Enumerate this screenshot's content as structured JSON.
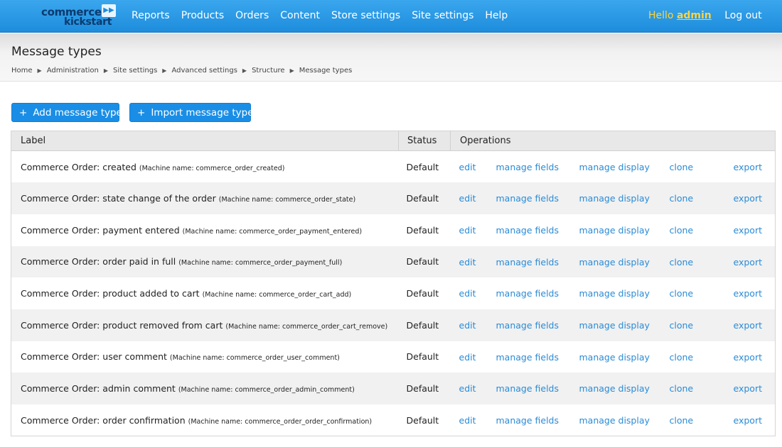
{
  "logo": {
    "line1": "commerce",
    "line2": "kickstart",
    "tm": "™"
  },
  "nav": [
    "Reports",
    "Products",
    "Orders",
    "Content",
    "Store settings",
    "Site settings",
    "Help"
  ],
  "user": {
    "hello": "Hello",
    "name": "admin",
    "logout": "Log out"
  },
  "page": {
    "title": "Message types",
    "breadcrumb": [
      "Home",
      "Administration",
      "Site settings",
      "Advanced settings",
      "Structure",
      "Message types"
    ]
  },
  "actions": {
    "add": "Add message type",
    "import": "Import message type"
  },
  "table": {
    "headers": {
      "label": "Label",
      "status": "Status",
      "operations": "Operations"
    },
    "op_labels": {
      "edit": "edit",
      "fields": "manage fields",
      "display": "manage display",
      "clone": "clone",
      "export": "export"
    },
    "rows": [
      {
        "label": "Commerce Order: created",
        "machine": "(Machine name: commerce_order_created)",
        "status": "Default"
      },
      {
        "label": "Commerce Order: state change of the order",
        "machine": "(Machine name: commerce_order_state)",
        "status": "Default"
      },
      {
        "label": "Commerce Order: payment entered",
        "machine": "(Machine name: commerce_order_payment_entered)",
        "status": "Default"
      },
      {
        "label": "Commerce Order: order paid in full",
        "machine": "(Machine name: commerce_order_payment_full)",
        "status": "Default"
      },
      {
        "label": "Commerce Order: product added to cart",
        "machine": "(Machine name: commerce_order_cart_add)",
        "status": "Default"
      },
      {
        "label": "Commerce Order: product removed from cart",
        "machine": "(Machine name: commerce_order_cart_remove)",
        "status": "Default"
      },
      {
        "label": "Commerce Order: user comment",
        "machine": "(Machine name: commerce_order_user_comment)",
        "status": "Default"
      },
      {
        "label": "Commerce Order: admin comment",
        "machine": "(Machine name: commerce_order_admin_comment)",
        "status": "Default"
      },
      {
        "label": "Commerce Order: order confirmation",
        "machine": "(Machine name: commerce_order_order_confirmation)",
        "status": "Default"
      }
    ]
  }
}
